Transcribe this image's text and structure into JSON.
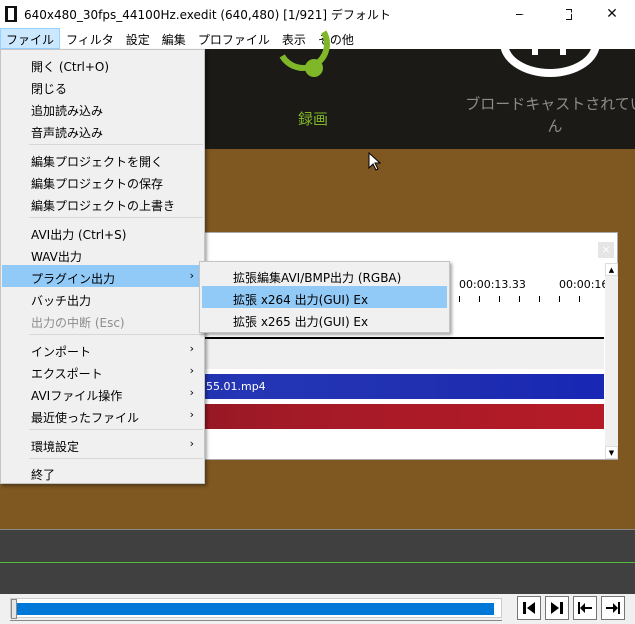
{
  "window": {
    "title": "640x480_30fps_44100Hz.exedit (640,480)  [1/921]  デフォルト",
    "minimize": "",
    "maximize": "",
    "close": "✕"
  },
  "menubar": {
    "items": [
      "ファイル",
      "フィルタ",
      "設定",
      "編集",
      "プロファイル",
      "表示",
      "その他"
    ]
  },
  "video": {
    "record_label": "録画",
    "broadcast_label_line1": "ブロードキャストされてい",
    "broadcast_label_line2": "ん"
  },
  "timeline": {
    "time_marker_1": "00:00:13.33",
    "time_marker_2": "00:00:16",
    "clip_label": "55.01.mp4",
    "close_label": "×"
  },
  "file_menu": {
    "groups": [
      [
        "開く (Ctrl+O)",
        "閉じる",
        "追加読み込み",
        "音声読み込み"
      ],
      [
        "編集プロジェクトを開く",
        "編集プロジェクトの保存",
        "編集プロジェクトの上書き"
      ],
      [
        "AVI出力 (Ctrl+S)",
        "WAV出力",
        "プラグイン出力",
        "バッチ出力",
        "出力の中断 (Esc)"
      ],
      [
        "インポート",
        "エクスポート",
        "AVIファイル操作",
        "最近使ったファイル"
      ],
      [
        "環境設定"
      ],
      [
        "終了"
      ]
    ],
    "highlighted": "プラグイン出力",
    "disabled": "出力の中断 (Esc)",
    "submenu_arrow": "›"
  },
  "plugin_submenu": {
    "items": [
      "拡張編集AVI/BMP出力 (RGBA)",
      "拡張 x264 出力(GUI) Ex",
      "拡張 x265 出力(GUI) Ex"
    ],
    "highlighted": "拡張 x264 出力(GUI) Ex"
  },
  "playback": {
    "progress_fraction": 0.99
  },
  "colors": {
    "menu_highlight": "#91c9f7",
    "record_green": "#7fb728",
    "timeline_blue": "#2030b0",
    "timeline_red": "#a51a27",
    "video_background": "#7e5721"
  }
}
